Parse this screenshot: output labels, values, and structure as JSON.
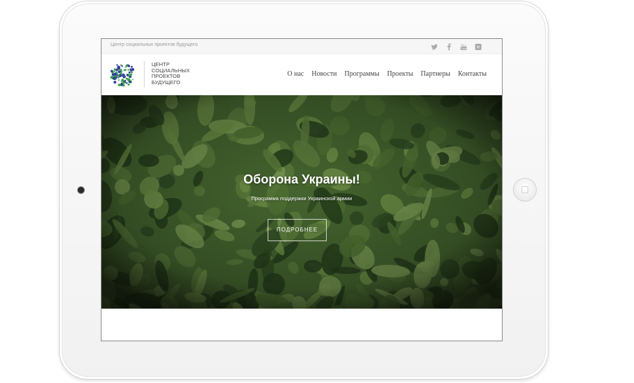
{
  "site": {
    "tagline": "Центр социальных проектов будущего",
    "logo_lines": [
      "ЦЕНТР",
      "СОЦИАЛЬНЫХ",
      "ПРОЕКТОВ",
      "БУДУЩЕГО"
    ]
  },
  "social_icons": [
    "twitter-icon",
    "facebook-icon",
    "youtube-icon",
    "vimeo-icon"
  ],
  "nav": {
    "items": [
      "О нас",
      "Новости",
      "Программы",
      "Проекты",
      "Партнеры",
      "Контакты"
    ]
  },
  "hero": {
    "title": "Оборона Украины!",
    "subtitle": "Программа поддержки Украинской армии",
    "button_label": "ПОДРОБНЕЕ"
  },
  "colors": {
    "hero_bg": "#3f5f2c",
    "logo_blue": "#2f3f9a",
    "logo_green": "#3aa14a"
  }
}
